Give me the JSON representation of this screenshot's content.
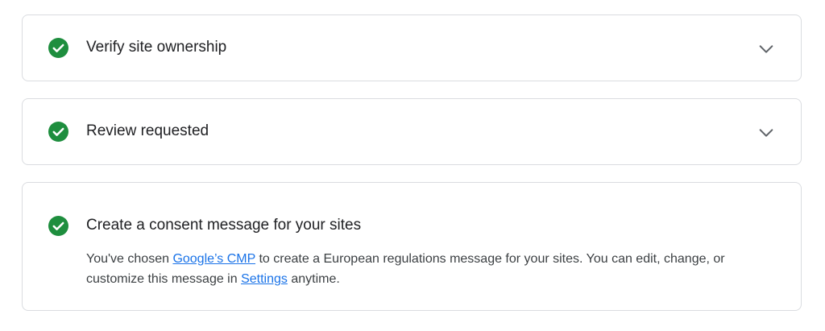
{
  "steps": [
    {
      "title": "Verify site ownership",
      "status": "complete",
      "expanded": false
    },
    {
      "title": "Review requested",
      "status": "complete",
      "expanded": false
    },
    {
      "title": "Create a consent message for your sites",
      "status": "complete",
      "expanded": true,
      "description": {
        "part1": "You've chosen ",
        "link1": "Google’s CMP",
        "part2": " to create a European regulations message for your sites. You can edit, change, or customize this message in ",
        "link2": "Settings",
        "part3": " anytime."
      }
    }
  ],
  "icons": {
    "status": "check-circle-icon",
    "expand": "chevron-down-icon"
  },
  "colors": {
    "success": "#1e8e3e",
    "link": "#1a73e8",
    "border": "#dadce0",
    "text": "#202124",
    "chevron": "#5f6368"
  }
}
